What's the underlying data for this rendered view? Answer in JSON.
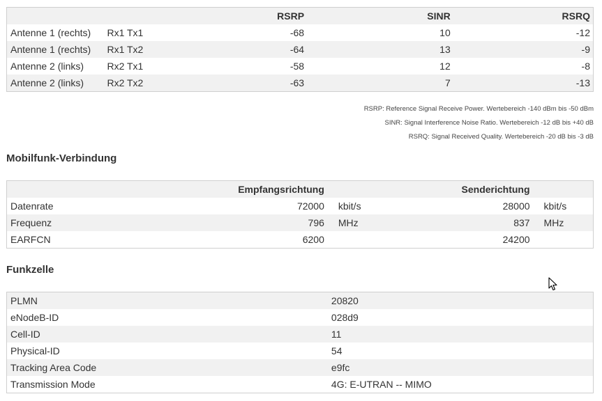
{
  "antenna_table": {
    "headers": [
      "",
      "",
      "RSRP",
      "SINR",
      "RSRQ"
    ],
    "rows": [
      [
        "Antenne 1 (rechts)",
        "Rx1 Tx1",
        "-68",
        "10",
        "-12"
      ],
      [
        "Antenne 1 (rechts)",
        "Rx1 Tx2",
        "-64",
        "13",
        "-9"
      ],
      [
        "Antenne 2 (links)",
        "Rx2 Tx1",
        "-58",
        "12",
        "-8"
      ],
      [
        "Antenne 2 (links)",
        "Rx2 Tx2",
        "-63",
        "7",
        "-13"
      ]
    ]
  },
  "legend": {
    "rsrp": "RSRP: Reference Signal Receive Power. Wertebereich -140 dBm bis -50 dBm",
    "sinr": "SINR: Signal Interference Noise Ratio. Wertebereich -12 dB bis +40 dB",
    "rsrq": "RSRQ: Signal Received Quality. Wertebereich -20 dB bis -3 dB"
  },
  "connection": {
    "title": "Mobilfunk-Verbindung",
    "headers": [
      "",
      "Empfangsrichtung",
      "",
      "Senderichtung",
      ""
    ],
    "rows": [
      [
        "Datenrate",
        "72000",
        "kbit/s",
        "28000",
        "kbit/s"
      ],
      [
        "Frequenz",
        "796",
        "MHz",
        "837",
        "MHz"
      ],
      [
        "EARFCN",
        "6200",
        "",
        "24200",
        ""
      ]
    ]
  },
  "cell": {
    "title": "Funkzelle",
    "rows": [
      [
        "PLMN",
        "20820"
      ],
      [
        "eNodeB-ID",
        "028d9"
      ],
      [
        "Cell-ID",
        "11"
      ],
      [
        "Physical-ID",
        "54"
      ],
      [
        "Tracking Area Code",
        "e9fc"
      ],
      [
        "Transmission Mode",
        "4G: E-UTRAN -- MIMO"
      ]
    ]
  }
}
